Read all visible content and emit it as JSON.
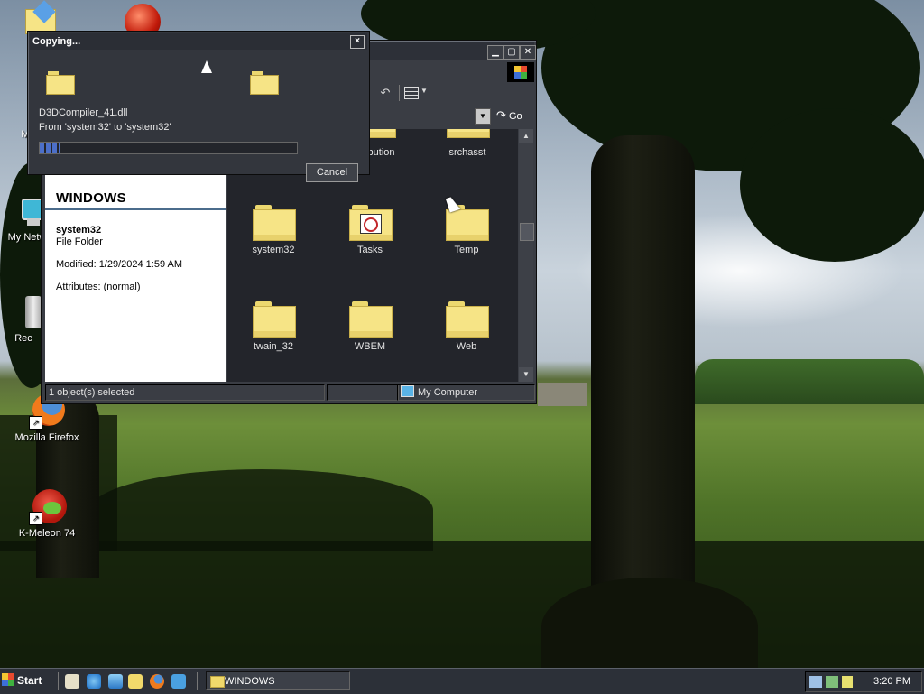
{
  "desktop_icons": [
    {
      "label": "My",
      "icon": "my-documents-icon"
    },
    {
      "label": "M",
      "icon": "my-computer-icon"
    },
    {
      "label": "My Netw",
      "icon": "my-network-places-icon"
    },
    {
      "label": "Rec",
      "icon": "recycle-bin-icon"
    },
    {
      "label": "Mozilla Firefox",
      "icon": "firefox-icon"
    },
    {
      "label": "K-Meleon 74",
      "icon": "k-meleon-icon"
    }
  ],
  "explorer": {
    "go_label": "Go",
    "left_pane": {
      "title": "WINDOWS",
      "item_name": "system32",
      "item_type": "File Folder",
      "modified": "Modified: 1/29/2024 1:59 AM",
      "attributes": "Attributes: (normal)"
    },
    "folders": [
      {
        "label": "istribution",
        "icon": "folder-icon"
      },
      {
        "label": "srchasst",
        "icon": "folder-icon"
      },
      {
        "label": "system32",
        "icon": "folder-icon"
      },
      {
        "label": "Tasks",
        "icon": "scheduled-tasks-folder-icon"
      },
      {
        "label": "Temp",
        "icon": "folder-icon"
      },
      {
        "label": "twain_32",
        "icon": "folder-icon"
      },
      {
        "label": "WBEM",
        "icon": "folder-icon"
      },
      {
        "label": "Web",
        "icon": "folder-icon"
      }
    ],
    "status": {
      "selected": "1 object(s) selected",
      "zone": "My Computer"
    }
  },
  "copy_dialog": {
    "title": "Copying...",
    "file_name": "D3DCompiler_41.dll",
    "from_to": "From 'system32' to 'system32'",
    "progress": 0.08,
    "cancel_label": "Cancel",
    "close_glyph": "×"
  },
  "taskbar": {
    "start_label": "Start",
    "quick_launch": [
      "show-desktop-icon",
      "internet-explorer-icon",
      "outlook-express-icon",
      "windows-explorer-icon",
      "firefox-icon",
      "messenger-icon"
    ],
    "task_label": "WINDOWS",
    "clock": "3:20 PM"
  },
  "colors": {
    "window_dark": "#3a3d44",
    "file_area": "#23252b",
    "folder_yellow": "#f6e486",
    "progress_blue": "#4c6fc9"
  }
}
